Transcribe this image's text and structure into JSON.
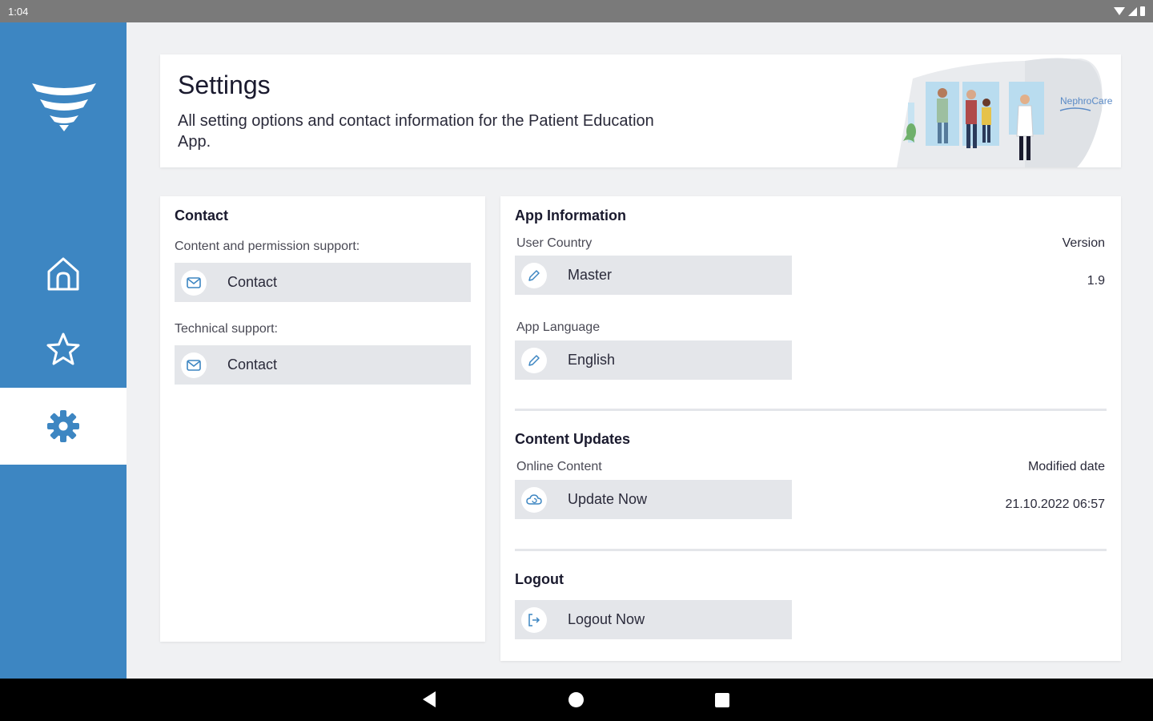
{
  "status_bar": {
    "time": "1:04"
  },
  "colors": {
    "brand_blue": "#3d86c2",
    "button_bg": "#e4e6ea",
    "background": "#f0f1f3"
  },
  "sidebar": {
    "items": [
      {
        "name": "home",
        "icon": "home-icon",
        "active": false
      },
      {
        "name": "favorites",
        "icon": "star-icon",
        "active": false
      },
      {
        "name": "settings",
        "icon": "gear-icon",
        "active": true
      }
    ]
  },
  "header": {
    "title": "Settings",
    "subtitle": "All setting options and contact information for the Patient Education App.",
    "illustration_brand": "NephroCare"
  },
  "contact": {
    "title": "Contact",
    "content_label": "Content and permission support:",
    "content_button": "Contact",
    "technical_label": "Technical support:",
    "technical_button": "Contact"
  },
  "app_info": {
    "title": "App Information",
    "country_label": "User Country",
    "country_value": "Master",
    "version_label": "Version",
    "version_value": "1.9",
    "language_label": "App Language",
    "language_value": "English"
  },
  "content_updates": {
    "title": "Content Updates",
    "online_label": "Online Content",
    "update_button": "Update Now",
    "modified_label": "Modified date",
    "modified_value": "21.10.2022 06:57"
  },
  "logout": {
    "title": "Logout",
    "button": "Logout Now"
  }
}
